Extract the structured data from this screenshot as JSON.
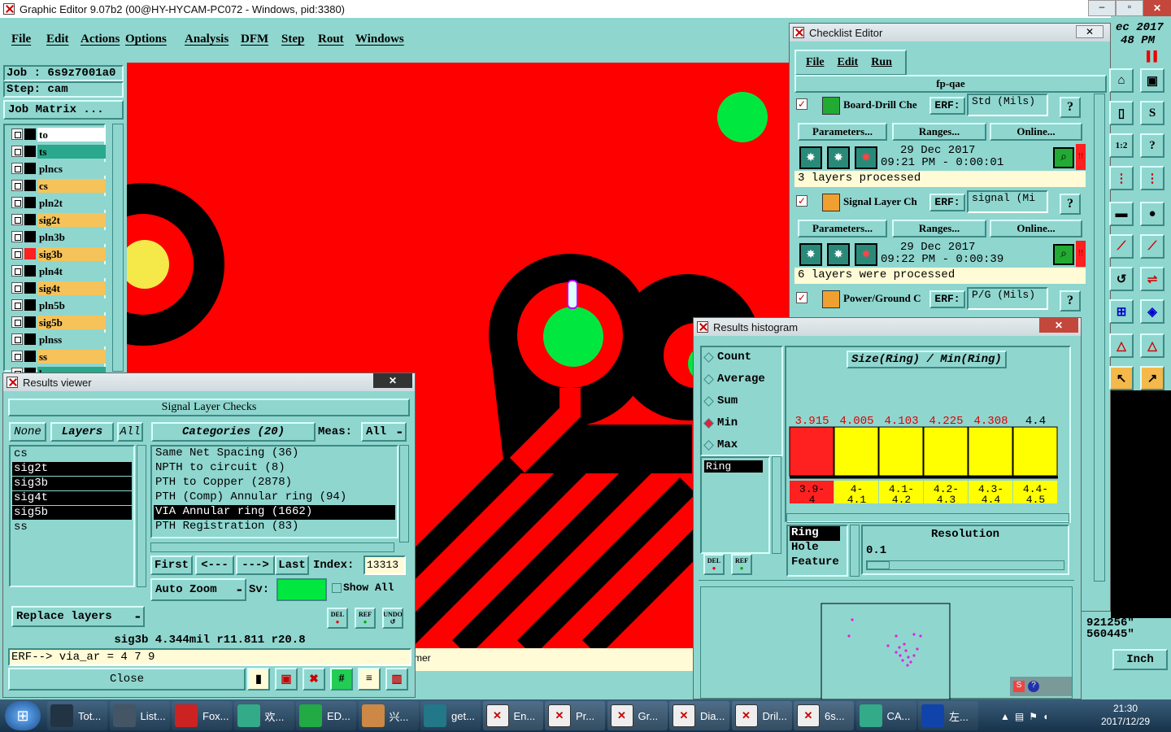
{
  "window": {
    "title": "Graphic Editor 9.07b2 (00@HY-HYCAM-PC072 - Windows, pid:3380)"
  },
  "menu": [
    "File",
    "Edit",
    "Actions",
    "Options",
    "Analysis",
    "DFM",
    "Step",
    "Rout",
    "Windows"
  ],
  "job": {
    "job_label": "Job : 6s9z7001a0",
    "step_label": "Step: cam",
    "matrix_button": "Job Matrix ..."
  },
  "layers": [
    {
      "name": "to",
      "color": "#ffffff"
    },
    {
      "name": "ts",
      "color": "#2aa88c"
    },
    {
      "name": "plncs",
      "color": "#8fd6cf"
    },
    {
      "name": "cs",
      "color": "#f5c35a"
    },
    {
      "name": "pln2t",
      "color": "#8fd6cf"
    },
    {
      "name": "sig2t",
      "color": "#f5c35a"
    },
    {
      "name": "pln3b",
      "color": "#8fd6cf"
    },
    {
      "name": "sig3b",
      "color": "#f5c35a"
    },
    {
      "name": "pln4t",
      "color": "#8fd6cf"
    },
    {
      "name": "sig4t",
      "color": "#f5c35a"
    },
    {
      "name": "pln5b",
      "color": "#8fd6cf"
    },
    {
      "name": "sig5b",
      "color": "#f5c35a"
    },
    {
      "name": "plnss",
      "color": "#8fd6cf"
    },
    {
      "name": "ss",
      "color": "#f5c35a"
    },
    {
      "name": "bs",
      "color": "#2aa88c"
    }
  ],
  "results_viewer": {
    "title": "Results viewer",
    "header": "Signal Layer Checks",
    "tab_none": "None",
    "tab_layers": "Layers",
    "tab_all": "All",
    "layer_list": [
      "cs",
      "sig2t",
      "sig3b",
      "sig4t",
      "sig5b",
      "ss"
    ],
    "categories_label": "Categories (20)",
    "meas_label": "Meas:",
    "meas_value": "All",
    "categories": [
      "Same Net Spacing (36)",
      "NPTH to circuit (8)",
      "PTH to Copper (2878)",
      "PTH (Comp) Annular ring (94)",
      "VIA Annular ring (1662)",
      "PTH Registration (83)"
    ],
    "first": "First",
    "prev": "<---",
    "next": "--->",
    "last": "Last",
    "index_label": "Index:",
    "index_value": "13313",
    "autozoom": "Auto Zoom",
    "sv_label": "Sv:",
    "show_all": "Show All",
    "replace_layers": "Replace layers",
    "status": "sig3b 4.344mil  r11.811  r20.8",
    "erf": "ERF--> via_ar = 4 7 9",
    "close": "Close",
    "mini_del": "DEL",
    "mini_ref": "REF",
    "mini_undo": "UNDO"
  },
  "checklist": {
    "title": "Checklist Editor",
    "menu": [
      "File",
      "Edit",
      "Run"
    ],
    "name": "fp-qae",
    "checks": [
      {
        "name": "Board-Drill Che",
        "erf": "ERF:",
        "erf_val": "Std (Mils)",
        "date": "29 Dec 2017",
        "time": "09:21 PM - 0:00:01",
        "status": "3 layers processed"
      },
      {
        "name": "Signal Layer Ch",
        "erf": "ERF:",
        "erf_val": "signal (Mi",
        "date": "29 Dec 2017",
        "time": "09:22 PM - 0:00:39",
        "status": "6 layers were processed"
      },
      {
        "name": "Power/Ground C",
        "erf": "ERF:",
        "erf_val": "P/G (Mils)"
      }
    ],
    "params": "Parameters...",
    "ranges": "Ranges...",
    "online": "Online...",
    "q": "?"
  },
  "histogram": {
    "title": "Results histogram",
    "options": [
      "Count",
      "Average",
      "Sum",
      "Min",
      "Max"
    ],
    "selected_option": "Min",
    "left_list": [
      "Ring"
    ],
    "chart_title": "Size(Ring) / Min(Ring)",
    "ring_list": [
      "Ring",
      "Hole",
      "Feature"
    ],
    "resolution_label": "Resolution",
    "resolution_value": "0.1",
    "del": "DEL",
    "ref": "REF"
  },
  "chart_data": {
    "type": "bar",
    "title": "Size(Ring) / Min(Ring)",
    "categories": [
      "3.9-4",
      "4-4.1",
      "4.1-4.2",
      "4.2-4.3",
      "4.3-4.4",
      "4.4-4.5"
    ],
    "values": [
      3.915,
      4.005,
      4.103,
      4.225,
      4.308,
      4.4
    ],
    "value_labels": [
      "3.915",
      "4.005",
      "4.103",
      "4.225",
      "4.308",
      "4.4"
    ],
    "colors": [
      "#ff2020",
      "#ffff00",
      "#ffff00",
      "#ffff00",
      "#ffff00",
      "#ffff00"
    ],
    "label_colors": [
      "#e00000",
      "#e00000",
      "#e00000",
      "#e00000",
      "#e00000",
      "#000000"
    ]
  },
  "right_panel": {
    "date_partial": "ec 2017",
    "time_partial": "48 PM",
    "coord1": "921256\"",
    "coord2": "560445\"",
    "units": "Inch"
  },
  "canvas_status": "mer",
  "taskbar": {
    "items": [
      "Tot...",
      "List...",
      "Fox...",
      "欢...",
      "ED...",
      "兴...",
      "get...",
      "En...",
      "Pr...",
      "Gr...",
      "Dia...",
      "Dril...",
      "6s...",
      "CA...",
      "左..."
    ],
    "time": "21:30",
    "date": "2017/12/29"
  }
}
